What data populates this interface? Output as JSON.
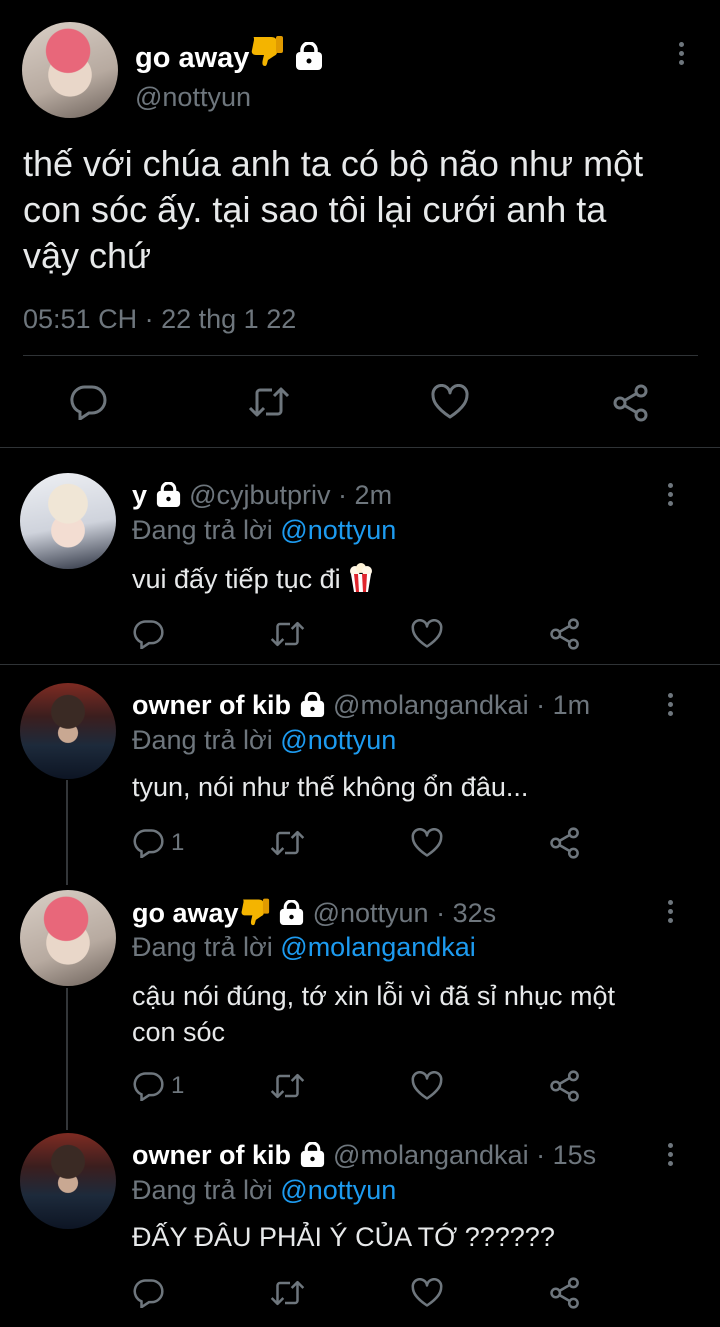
{
  "main": {
    "name": "go away",
    "handle": "@nottyun",
    "text_lines": [
      "thế với chúa anh ta có bộ não như một",
      "con sóc ấy. tại sao tôi lại cưới anh ta",
      "vậy chứ"
    ],
    "time": "05:51 CH",
    "sep": "·",
    "date": "22 thg 1 22"
  },
  "replies": [
    {
      "name": "y",
      "handle": "@cyjbutpriv",
      "time": "2m",
      "replying_prefix": "Đang trả lời",
      "replying_to": "@nottyun",
      "text_lines": [
        "vui đấy tiếp tục đi"
      ],
      "reply_count": ""
    },
    {
      "name": "owner of kib",
      "handle": "@molangandkai",
      "time": "1m",
      "replying_prefix": "Đang trả lời",
      "replying_to": "@nottyun",
      "text_lines": [
        "tyun, nói như thế không ổn đâu..."
      ],
      "reply_count": "1"
    },
    {
      "name": "go away",
      "handle": "@nottyun",
      "time": "32s",
      "replying_prefix": "Đang trả lời",
      "replying_to": "@molangandkai",
      "text_lines": [
        "cậu nói đúng, tớ xin lỗi vì đã sỉ nhục một",
        "con sóc"
      ],
      "reply_count": "1"
    },
    {
      "name": "owner of kib",
      "handle": "@molangandkai",
      "time": "15s",
      "replying_prefix": "Đang trả lời",
      "replying_to": "@nottyun",
      "text_lines": [
        "ĐẤY ĐÂU PHẢI Ý CỦA TỚ ??????"
      ],
      "reply_count": ""
    }
  ],
  "separator": "·",
  "icons": [
    "thumbs-down-emoji",
    "lock-icon",
    "popcorn-emoji",
    "more-icon",
    "reply-icon",
    "retweet-icon",
    "like-icon",
    "share-icon"
  ],
  "colors": {
    "background": "#000000",
    "text": "#e7e9ea",
    "muted": "#6e767d",
    "link": "#1d9bf0",
    "divider": "#2f3336"
  }
}
